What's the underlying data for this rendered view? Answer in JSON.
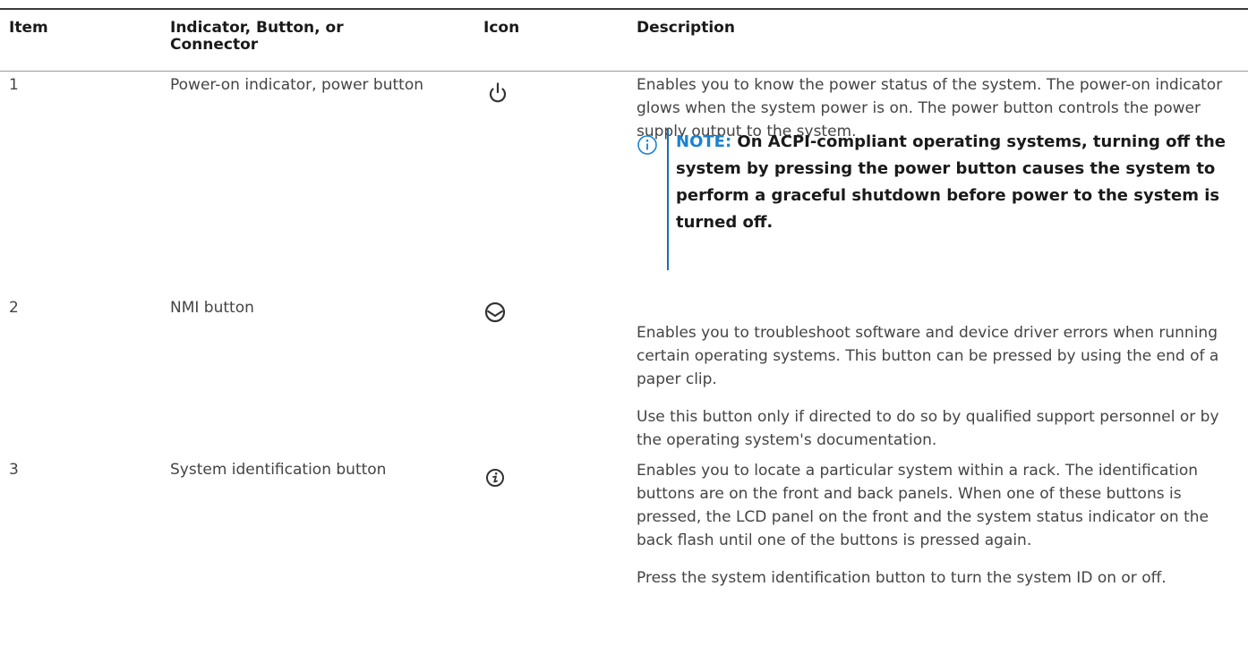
{
  "table": {
    "headers": {
      "item": "Item",
      "indicator": "Indicator, Button, or Connector",
      "icon": "Icon",
      "description": "Description"
    },
    "rows": [
      {
        "item": "1",
        "indicator": "Power-on indicator, power button",
        "icon": "power-icon",
        "description": [
          "Enables you to know the power status of the system. The power-on indicator glows when the system power is on. The power button controls the power supply output to the system."
        ],
        "note": {
          "label": "NOTE:",
          "text": "On ACPI-compliant operating systems, turning off the system by pressing the power button causes the system to perform a graceful shutdown before power to the system is turned off."
        }
      },
      {
        "item": "2",
        "indicator": "NMI button",
        "icon": "nmi-icon",
        "description": [
          "Enables you to troubleshoot software and device driver errors when running certain operating systems. This button can be pressed by using the end of a paper clip.",
          "Use this button only if directed to do so by qualified support personnel or by the operating system's documentation."
        ]
      },
      {
        "item": "3",
        "indicator": "System identification button",
        "icon": "system-id-icon",
        "description": [
          "Enables you to locate a particular system within a rack. The identification buttons are on the front and back panels. When one of these buttons is pressed, the LCD panel on the front and the system status indicator on the back flash until one of the buttons is pressed again.",
          "Press the system identification button to turn the system ID on or off."
        ]
      }
    ]
  },
  "colors": {
    "note_accent": "#1a82d2",
    "note_bar": "#1a6db5",
    "text": "#444444"
  }
}
